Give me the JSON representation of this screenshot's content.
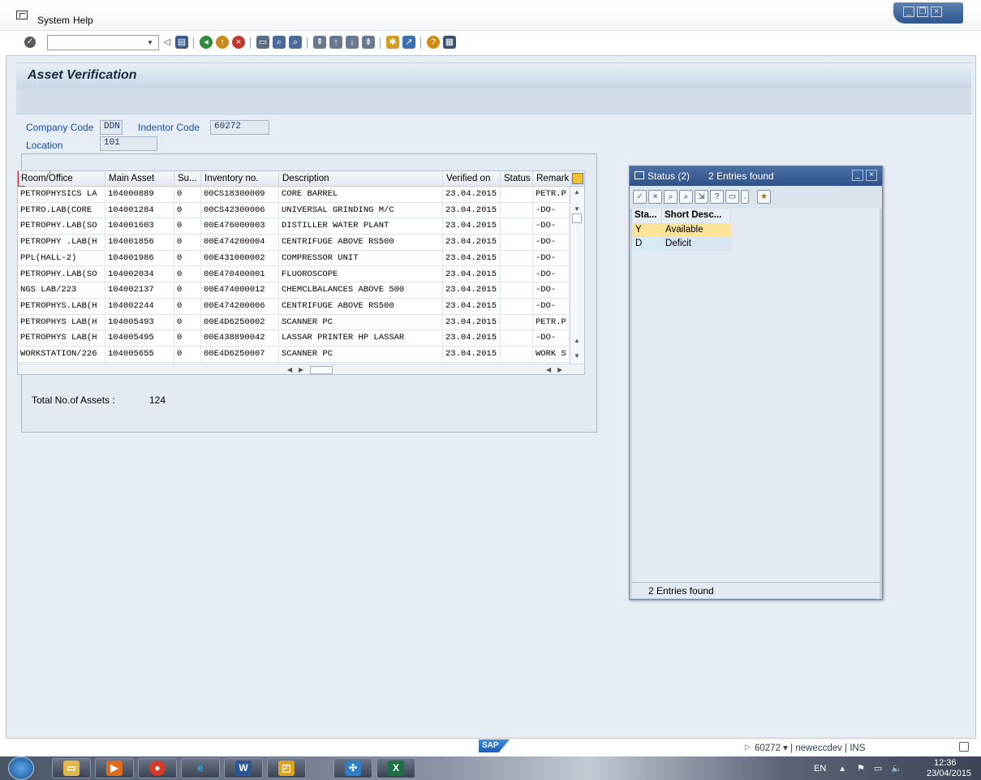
{
  "menubar": {
    "menus": [
      "System",
      "Help"
    ]
  },
  "toolbar": {
    "command_field": ""
  },
  "page": {
    "title": "Asset Verification"
  },
  "header_fields": {
    "company_code_label": "Company Code",
    "company_code_value": "DDN",
    "indentor_code_label": "Indentor Code",
    "indentor_code_value": "60272",
    "location_label": "Location",
    "location_value": "101"
  },
  "table": {
    "columns": [
      "Room/Office",
      "Main Asset",
      "Su...",
      "Inventory no.",
      "Description",
      "Verified on",
      "Status",
      "Remark"
    ],
    "rows": [
      [
        "PETROPHYSICS LA",
        "104000889",
        "0",
        "00CS18300009",
        "CORE BARREL",
        "23.04.2015",
        "",
        "PETR.P"
      ],
      [
        "PETRO.LAB(CORE",
        "104001284",
        "0",
        "00CS42300006",
        "UNIVERSAL GRINDING M/C",
        "23.04.2015",
        "",
        "-DO-"
      ],
      [
        "PETROPHY.LAB(SO",
        "104001603",
        "0",
        "00E476000003",
        "DISTILLER WATER PLANT",
        "23.04.2015",
        "",
        "-DO-"
      ],
      [
        "PETROPHY .LAB(H",
        "104001856",
        "0",
        "00E474200004",
        "CENTRIFUGE ABOVE RS500",
        "23.04.2015",
        "",
        "-DO-"
      ],
      [
        "PPL(HALL-2)",
        "104001986",
        "0",
        "00E431000002",
        "COMPRESSOR UNIT",
        "23.04.2015",
        "",
        "-DO-"
      ],
      [
        "PETROPHY.LAB(SO",
        "104002034",
        "0",
        "00E470400001",
        "FLUOROSCOPE",
        "23.04.2015",
        "",
        "-DO-"
      ],
      [
        "NGS LAB/223",
        "104002137",
        "0",
        "00E474000012",
        "CHEMCLBALANCES ABOVE 500",
        "23.04.2015",
        "",
        "-DO-"
      ],
      [
        "PETROPHYS.LAB(H",
        "104002244",
        "0",
        "00E474200006",
        "CENTRIFUGE ABOVE RS500",
        "23.04.2015",
        "",
        "-DO-"
      ],
      [
        "PETROPHYS LAB(H",
        "104005493",
        "0",
        "00E4D6250002",
        "SCANNER PC",
        "23.04.2015",
        "",
        "PETR.P"
      ],
      [
        "PETROPHYS LAB(H",
        "104005495",
        "0",
        "00E438890042",
        "LASSAR PRINTER HP LASSAR",
        "23.04.2015",
        "",
        "-DO-"
      ],
      [
        "WORKSTATION/226",
        "104005655",
        "0",
        "00E4D6250007",
        "SCANNER PC",
        "23.04.2015",
        "",
        "WORK S"
      ]
    ]
  },
  "totals": {
    "label": "Total No.of Assets :",
    "value": "124"
  },
  "popup": {
    "title": "Status (2)",
    "subtitle": "2 Entries found",
    "columns": [
      "Sta...",
      "Short Desc..."
    ],
    "rows": [
      [
        "Y",
        "Available"
      ],
      [
        "D",
        "Deficit"
      ]
    ],
    "status_text": "2 Entries found"
  },
  "statusbar": {
    "logo": "SAP",
    "info": "60272 ▾ | neweccdev | INS"
  },
  "taskbar": {
    "lang": "EN",
    "time": "12:36",
    "date": "23/04/2015"
  },
  "colors": {
    "label_blue": "#1a4cb4",
    "selected_row": "#fbe49a",
    "title_bar": "#2f5189"
  }
}
